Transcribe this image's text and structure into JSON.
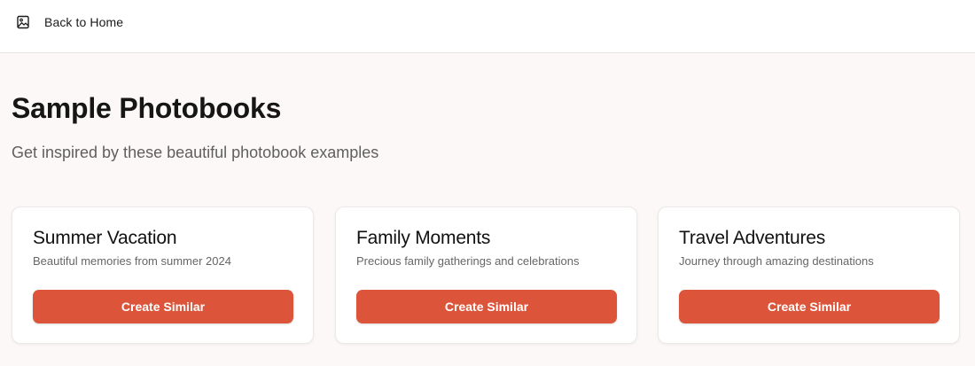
{
  "header": {
    "back_label": "Back to Home",
    "back_icon": "image-icon"
  },
  "page": {
    "title": "Sample Photobooks",
    "subtitle": "Get inspired by these beautiful photobook examples"
  },
  "cards": [
    {
      "title": "Summer Vacation",
      "description": "Beautiful memories from summer 2024",
      "button_label": "Create Similar"
    },
    {
      "title": "Family Moments",
      "description": "Precious family gatherings and celebrations",
      "button_label": "Create Similar"
    },
    {
      "title": "Travel Adventures",
      "description": "Journey through amazing destinations",
      "button_label": "Create Similar"
    }
  ],
  "colors": {
    "accent": "#dc553b",
    "background": "#fcf8f8"
  }
}
